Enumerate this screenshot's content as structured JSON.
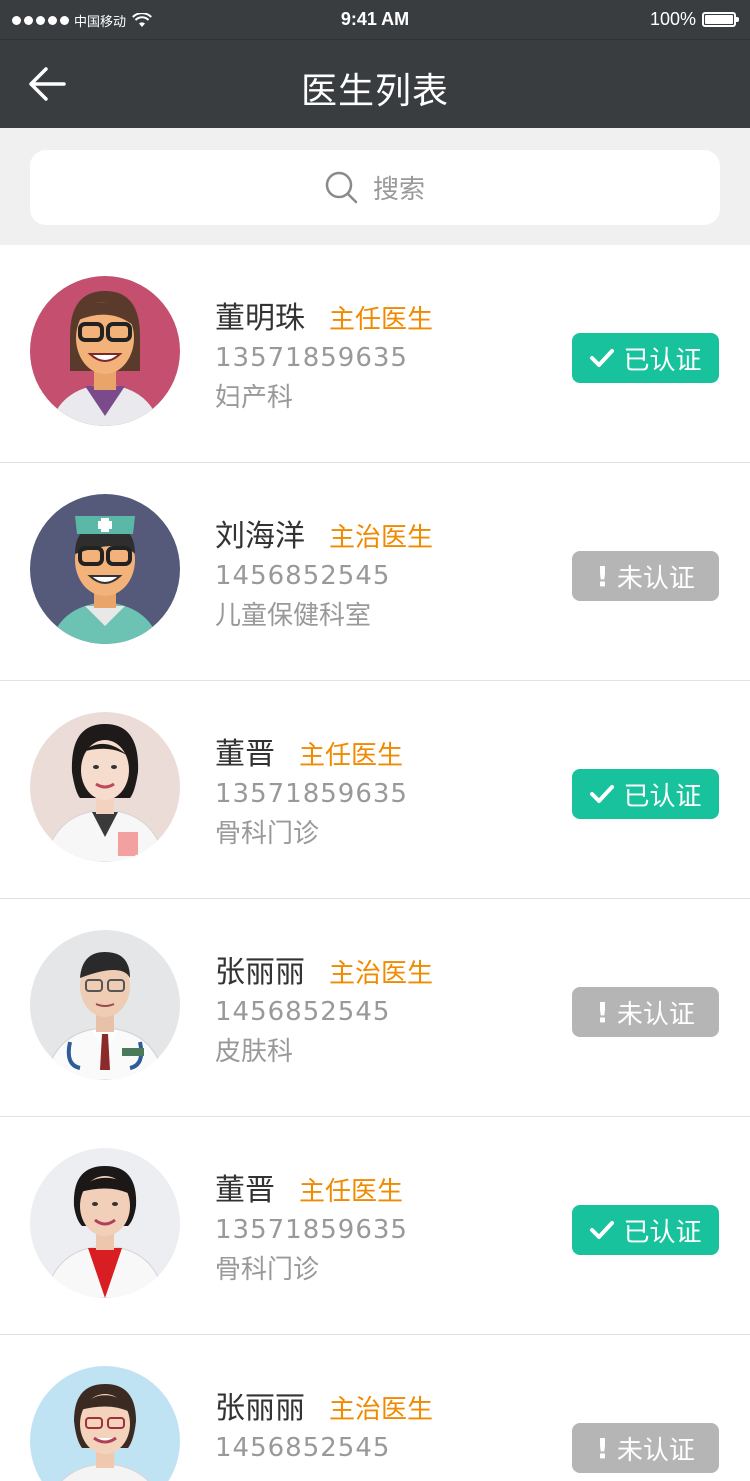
{
  "status_bar": {
    "carrier": "中国移动",
    "time": "9:41 AM",
    "battery": "100%"
  },
  "nav": {
    "title": "医生列表",
    "back_icon": "arrow-left-icon"
  },
  "search": {
    "placeholder": "搜索",
    "icon": "search-icon"
  },
  "doctors": [
    {
      "name": "董明珠",
      "title": "主任医生",
      "phone": "13571859635",
      "department": "妇产科",
      "status": "已认证",
      "verified": true,
      "avatar": "illustrated-female-doctor"
    },
    {
      "name": "刘海洋",
      "title": "主治医生",
      "phone": "1456852545",
      "department": "儿童保健科室",
      "status": "未认证",
      "verified": false,
      "avatar": "illustrated-nurse"
    },
    {
      "name": "董晋",
      "title": "主任医生",
      "phone": "13571859635",
      "department": "骨科门诊",
      "status": "已认证",
      "verified": true,
      "avatar": "photo-female-doctor"
    },
    {
      "name": "张丽丽",
      "title": "主治医生",
      "phone": "1456852545",
      "department": "皮肤科",
      "status": "未认证",
      "verified": false,
      "avatar": "photo-male-doctor"
    },
    {
      "name": "董晋",
      "title": "主任医生",
      "phone": "13571859635",
      "department": "骨科门诊",
      "status": "已认证",
      "verified": true,
      "avatar": "photo-female-doctor-red"
    },
    {
      "name": "张丽丽",
      "title": "主治医生",
      "phone": "1456852545",
      "department": "",
      "status": "未认证",
      "verified": false,
      "avatar": "photo-female-doctor-glasses"
    }
  ],
  "colors": {
    "header_bg": "#3a3d40",
    "title_orange": "#f08a00",
    "verified_green": "#18c29c",
    "unverified_gray": "#b5b5b5"
  }
}
